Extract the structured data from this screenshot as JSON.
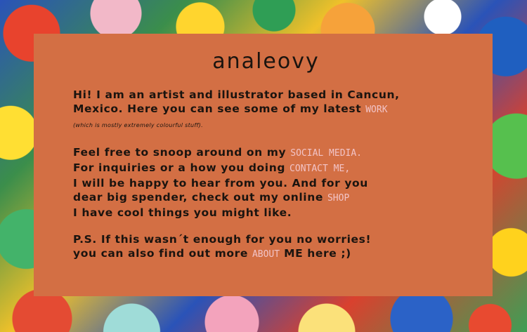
{
  "site": {
    "title": "analeovy"
  },
  "intro": {
    "line1": "Hi! I am an artist and illustrator based in Cancun,",
    "line2": "Mexico. Here you can see some of my latest",
    "work_link": "WORK",
    "note": "(which is mostly extremely colourful stuff)."
  },
  "para2": {
    "line1": "Feel free to snoop around on my",
    "social_link": "SOCIAL MEDIA.",
    "line2": "For inquiries or a how you doing",
    "contact_link": "CONTACT ME,",
    "line3": "I will be happy to hear from you. And for you",
    "line4": "dear big spender, check out my online",
    "shop_link": "SHOP",
    "line5": "I have cool things you might like."
  },
  "ps": {
    "line1": "P.S.  If this wasn´t enough for you no worries!",
    "line2_start": "you can also find out more",
    "about_link": "ABOUT",
    "line2_end": "ME here ;)"
  },
  "colors": {
    "card": "#d36f44",
    "link": "#f2c3c6",
    "text": "#1b140f"
  }
}
